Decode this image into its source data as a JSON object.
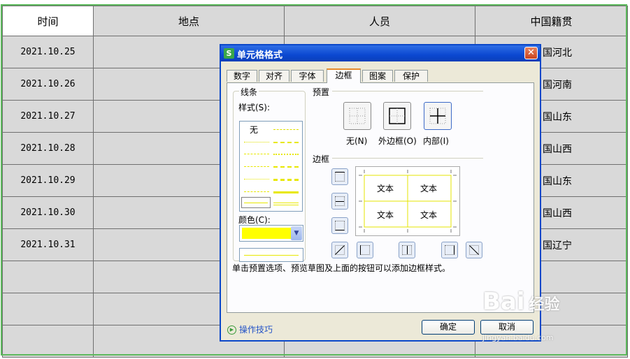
{
  "sheet": {
    "headers": [
      "时间",
      "地点",
      "人员",
      "中国籍贯"
    ],
    "rows": [
      {
        "date": "2021.10.25",
        "origin": "国河北"
      },
      {
        "date": "2021.10.26",
        "origin": "国河南"
      },
      {
        "date": "2021.10.27",
        "origin": "国山东"
      },
      {
        "date": "2021.10.28",
        "origin": "国山西"
      },
      {
        "date": "2021.10.29",
        "origin": "国山东"
      },
      {
        "date": "2021.10.30",
        "origin": "国山西"
      },
      {
        "date": "2021.10.31",
        "origin": "国辽宁"
      }
    ]
  },
  "dialog": {
    "title": "单元格格式",
    "app_icon": "S",
    "close_glyph": "✕",
    "tabs": [
      "数字",
      "对齐",
      "字体",
      "边框",
      "图案",
      "保护"
    ],
    "active_tab": "边框",
    "line_group": "线条",
    "style_label": "样式(S):",
    "style_none": "无",
    "color_label": "颜色(C):",
    "color_value": "#ffff00",
    "preset_group": "预置",
    "presets": [
      "无(N)",
      "外边框(O)",
      "内部(I)"
    ],
    "border_group": "边框",
    "preview_text": [
      "文本",
      "文本",
      "文本",
      "文本"
    ],
    "hint": "单击预置选项、预览草图及上面的按钮可以添加边框样式。",
    "tips": "操作技巧",
    "ok": "确定",
    "cancel": "取消"
  },
  "watermark": {
    "logo": "Bai",
    "logo2": "经验",
    "url": "jingyan.baidu.com"
  }
}
